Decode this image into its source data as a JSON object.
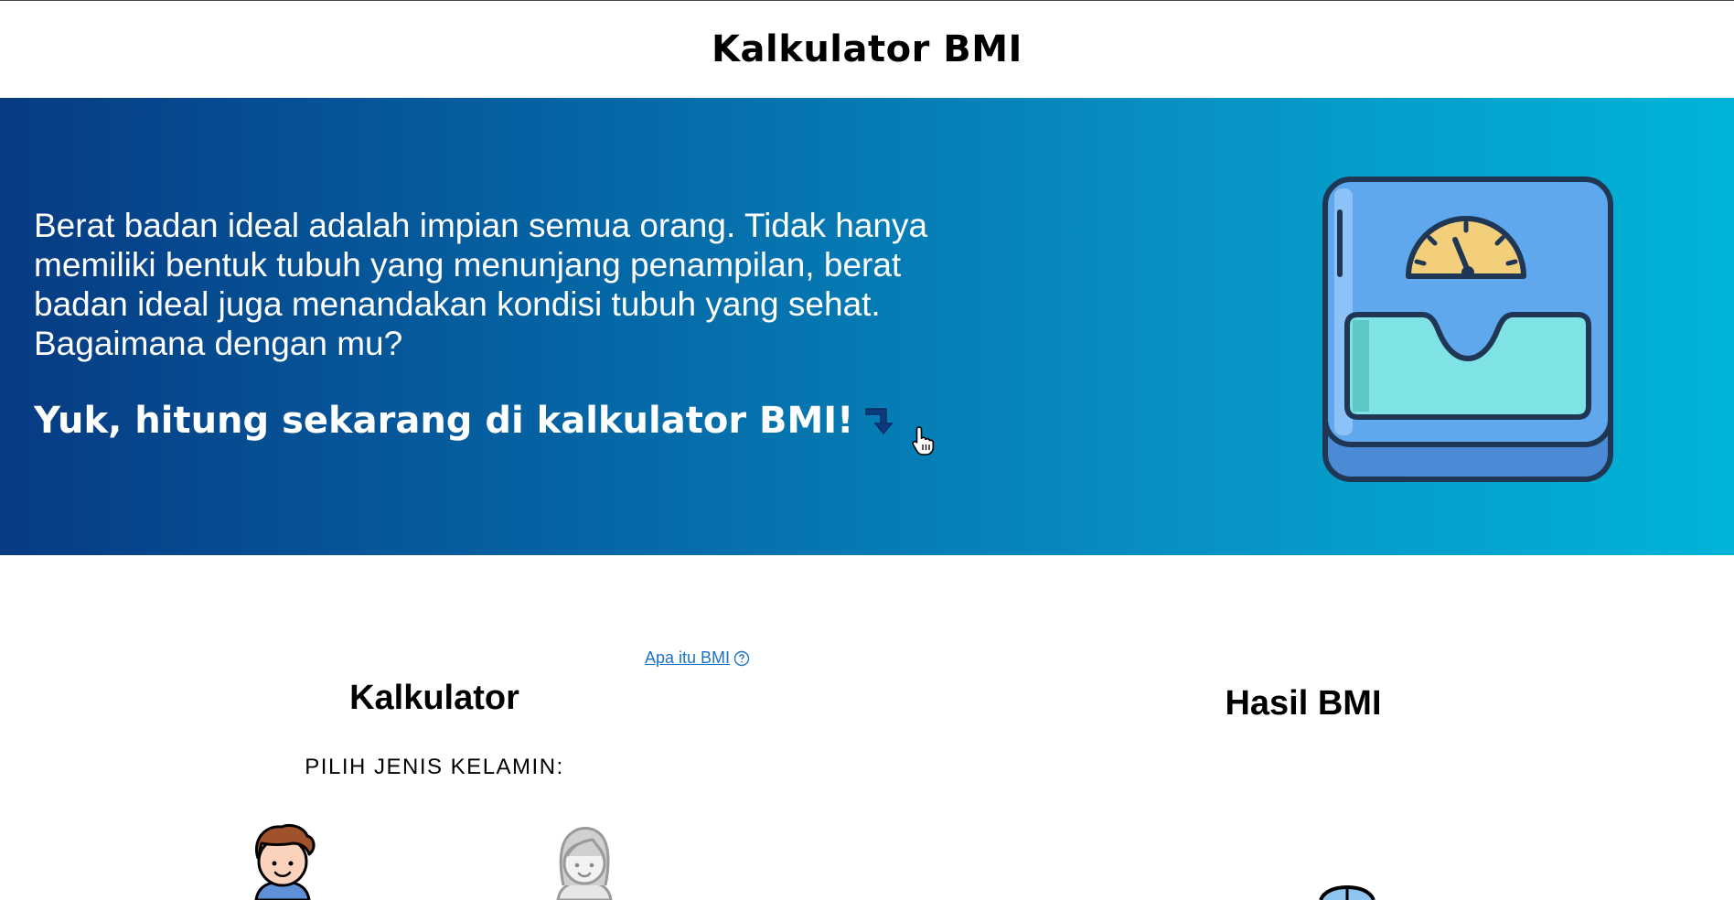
{
  "header": {
    "title": "Kalkulator BMI"
  },
  "hero": {
    "paragraph": "Berat badan ideal adalah impian semua orang. Tidak hanya memiliki bentuk tubuh yang menunjang penampilan, berat badan ideal juga menandakan kondisi tubuh yang sehat. Bagaimana dengan mu?",
    "cta": "Yuk, hitung sekarang di kalkulator BMI!",
    "icons": {
      "arrow": "arrow-turn-down-icon",
      "scale": "weight-scale-icon",
      "cursor": "hand-pointer-icon"
    }
  },
  "calculator": {
    "info_link": "Apa itu BMI",
    "title": "Kalkulator",
    "gender_label": "PILIH JENIS KELAMIN:",
    "genders": [
      "male-avatar-icon",
      "female-avatar-icon"
    ]
  },
  "result": {
    "title": "Hasil BMI"
  },
  "colors": {
    "hero_gradient_start": "#073b83",
    "hero_gradient_end": "#00b4d8",
    "link": "#1a73c8",
    "scale_body": "#5fa8ee",
    "scale_dial": "#f3cf7b",
    "scale_platform": "#7fe3e6"
  }
}
